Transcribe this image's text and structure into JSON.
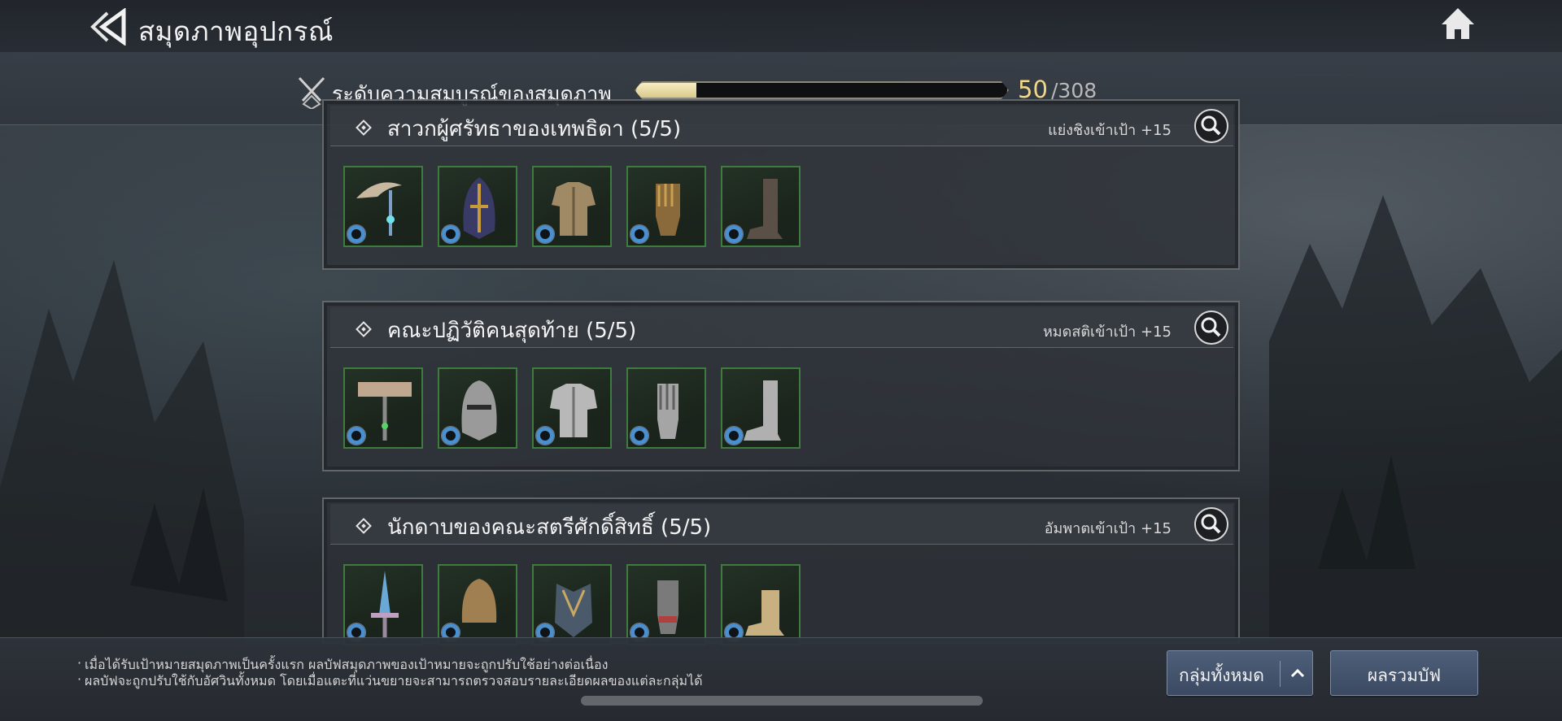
{
  "header": {
    "title": "สมุดภาพอุปกรณ์",
    "back_icon": "double-chevron-left-icon",
    "home_icon": "home-icon"
  },
  "completion": {
    "label": "ระดับความสมบูรณ์ของสมุดภาพ",
    "current": "50",
    "total": "/308",
    "fraction": 0.162
  },
  "collections": [
    {
      "title": "สาวกผู้ศรัทธาของเทพธิดา (5/5)",
      "bonus": "แย่งชิงเข้าเป้า +15",
      "items": [
        "axe-icon",
        "helmet-icon",
        "armor-icon",
        "gloves-icon",
        "boots-icon"
      ],
      "grade_color": "#4a8fd0"
    },
    {
      "title": "คณะปฏิวัติคนสุดท้าย (5/5)",
      "bonus": "หมดสติเข้าเป้า +15",
      "items": [
        "hammer-icon",
        "helmet-icon",
        "armor-icon",
        "gloves-icon",
        "boots-icon"
      ],
      "grade_color": "#4a8fd0"
    },
    {
      "title": "นักดาบของคณะสตรีศักดิ์สิทธิ์ (5/5)",
      "bonus": "อัมพาตเข้าเป้า +15",
      "items": [
        "sword-icon",
        "helmet-icon",
        "armor-icon",
        "gloves-icon",
        "boots-icon"
      ],
      "grade_color": "#4a8fd0"
    }
  ],
  "footer": {
    "notes": [
      "เมื่อได้รับเป้าหมายสมุดภาพเป็นครั้งแรก ผลบัฟสมุดภาพของเป้าหมายจะถูกปรับใช้อย่างต่อเนื่อง",
      "ผลบัฟจะถูกปรับใช้กับอัศวินทั้งหมด โดยเมื่อแตะที่แว่นขยายจะสามารถตรวจสอบรายละเอียดผลของแต่ละกลุ่มได้"
    ],
    "group_button": "กลุ่มทั้งหมด",
    "buff_button": "ผลรวมบัฟ"
  }
}
